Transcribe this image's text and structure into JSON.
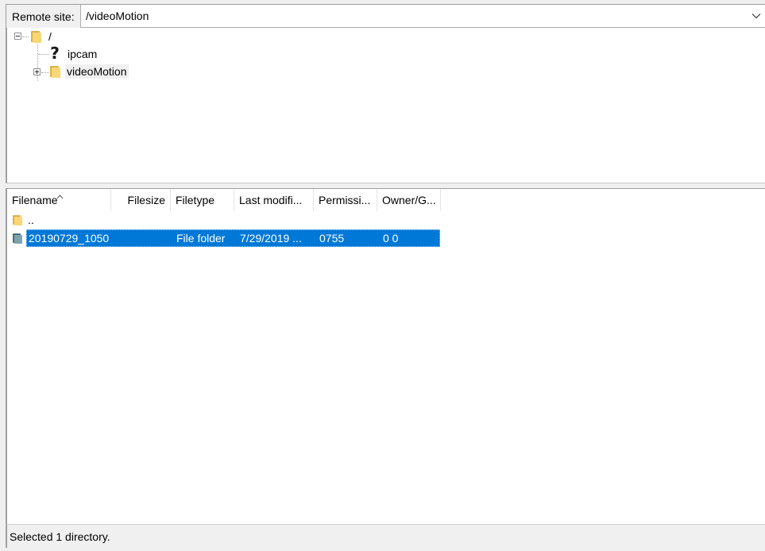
{
  "remote_site": {
    "label": "Remote site:",
    "path": "/videoMotion"
  },
  "tree": {
    "root": {
      "label": "/",
      "icon": "folder-icon",
      "expanded": true
    },
    "children": [
      {
        "label": "ipcam",
        "icon": "question-icon"
      },
      {
        "label": "videoMotion",
        "icon": "folder-icon",
        "expandable": true
      }
    ]
  },
  "file_list": {
    "columns": [
      "Filename",
      "Filesize",
      "Filetype",
      "Last modifi...",
      "Permissi...",
      "Owner/G..."
    ],
    "parent_row": {
      "name": ".."
    },
    "rows": [
      {
        "name": "20190729_1050",
        "size": "",
        "type": "File folder",
        "modified": "7/29/2019 ...",
        "permissions": "0755",
        "owner": "0 0",
        "selected": true
      }
    ]
  },
  "status": {
    "text": "Selected 1 directory."
  },
  "colors": {
    "selection": "#0078d7",
    "folder": "#f8d775",
    "folder_dark": "#dcb24a"
  }
}
